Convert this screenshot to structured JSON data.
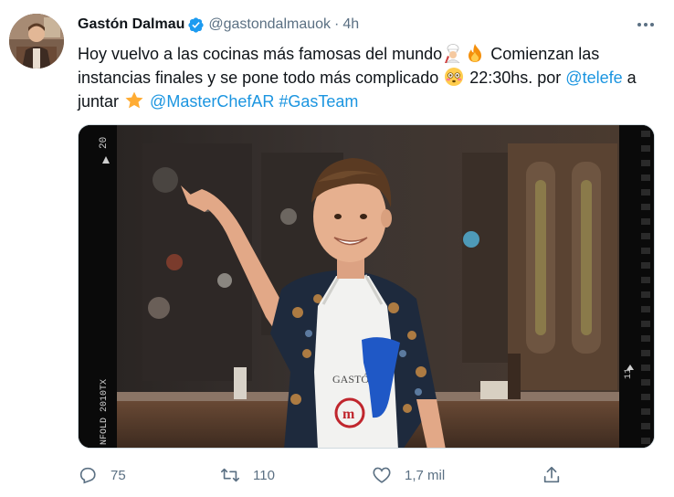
{
  "tweet": {
    "author_name": "Gastón Dalmau",
    "handle": "@gastondalmauok",
    "separator": "·",
    "time": "4h",
    "text": {
      "line1_a": "Hoy vuelvo a las cocinas más famosas del mundo",
      "line1_b": " Comienzan las",
      "line2_a": "instancias finales y se pone todo más complicado ",
      "line2_b": " 22:30hs. por ",
      "mention_telefe": "@telefe",
      "line2_c": " a",
      "line3_a": "juntar ",
      "mention_masterchef": "@MasterChefAR",
      "hashtag": "#GasTeam"
    },
    "image": {
      "film_edge_number": "20",
      "film_edge_text": "NFOLD 2010TX",
      "film_frame_number": "11",
      "apron_name": "GASTÓN"
    },
    "actions": {
      "replies": "75",
      "retweets": "110",
      "likes": "1,7 mil"
    },
    "icons": {
      "verified": "verified-badge-icon",
      "more": "more-options-icon",
      "reply": "reply-icon",
      "retweet": "retweet-icon",
      "like": "heart-icon",
      "share": "share-icon"
    },
    "colors": {
      "link": "#1b95e0",
      "secondary_text": "#5b7083",
      "verified_badge": "#1d9bf0"
    }
  }
}
